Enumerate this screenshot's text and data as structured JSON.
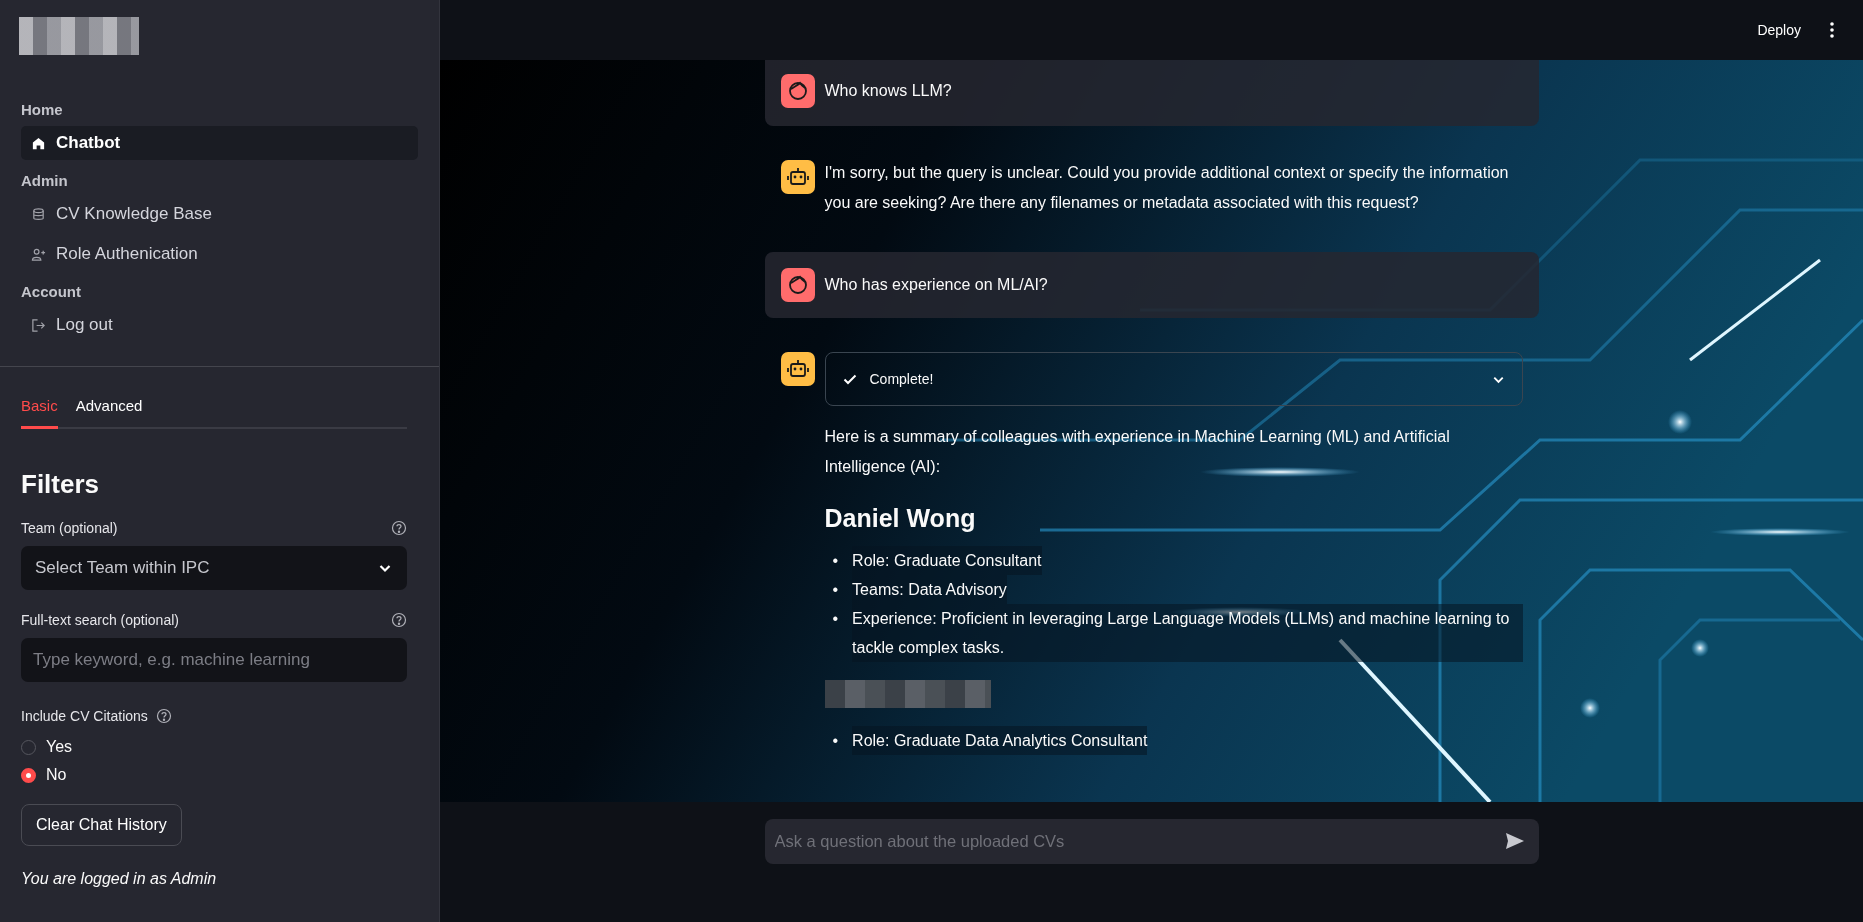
{
  "header": {
    "deploy": "Deploy"
  },
  "sidebar": {
    "nav": [
      {
        "heading": "Home",
        "items": [
          {
            "label": "Chatbot",
            "selected": true
          }
        ]
      },
      {
        "heading": "Admin",
        "items": [
          {
            "label": "CV Knowledge Base",
            "selected": false
          },
          {
            "label": "Role Authenication",
            "selected": false
          }
        ]
      },
      {
        "heading": "Account",
        "items": [
          {
            "label": "Log out",
            "selected": false
          }
        ]
      }
    ],
    "tabs": [
      {
        "label": "Basic",
        "selected": true
      },
      {
        "label": "Advanced",
        "selected": false
      }
    ],
    "filters": {
      "title": "Filters",
      "team": {
        "label": "Team (optional)",
        "placeholder": "Select Team within IPC"
      },
      "search": {
        "label": "Full-text search (optional)",
        "placeholder": "Type keyword, e.g. machine learning"
      },
      "citations": {
        "label": "Include CV Citations",
        "options": [
          {
            "label": "Yes",
            "selected": false
          },
          {
            "label": "No",
            "selected": true
          }
        ]
      },
      "clear_button": "Clear Chat History",
      "note": "You are logged in as Admin"
    }
  },
  "messages": [
    {
      "kind": "user",
      "blocks": [
        {
          "kind": "paragraph",
          "text": "Who knows LLM?"
        }
      ]
    },
    {
      "kind": "assistant",
      "blocks": [
        {
          "kind": "paragraph",
          "text": "I'm sorry, but the query is unclear. Could you provide additional context or specify the information you are seeking? Are there any filenames or metadata associated with this request?"
        }
      ]
    },
    {
      "kind": "user",
      "blocks": [
        {
          "kind": "paragraph",
          "text": "Who has experience on ML/AI?"
        }
      ]
    },
    {
      "kind": "assistant",
      "blocks": [
        {
          "kind": "status",
          "text": "Complete!",
          "expanded": false
        },
        {
          "kind": "paragraph",
          "text": "Here is a summary of colleagues with experience in Machine Learning (ML) and Artificial Intelligence (AI):"
        },
        {
          "kind": "heading",
          "text": "Daniel Wong"
        },
        {
          "kind": "bullets",
          "items": [
            {
              "marker": "•",
              "text": "Role: Graduate Consultant"
            },
            {
              "marker": "•",
              "text": "Teams: Data Advisory"
            },
            {
              "marker": "•",
              "text": "Experience: Proficient in leveraging Large Language Models (LLMs) and machine learning to tackle complex tasks."
            }
          ]
        },
        {
          "kind": "redacted"
        },
        {
          "kind": "bullets",
          "items": [
            {
              "marker": "•",
              "text": "Role: Graduate Data Analytics Consultant"
            }
          ]
        }
      ]
    }
  ],
  "chat_input": {
    "placeholder": "Ask a question about the uploaded CVs"
  }
}
